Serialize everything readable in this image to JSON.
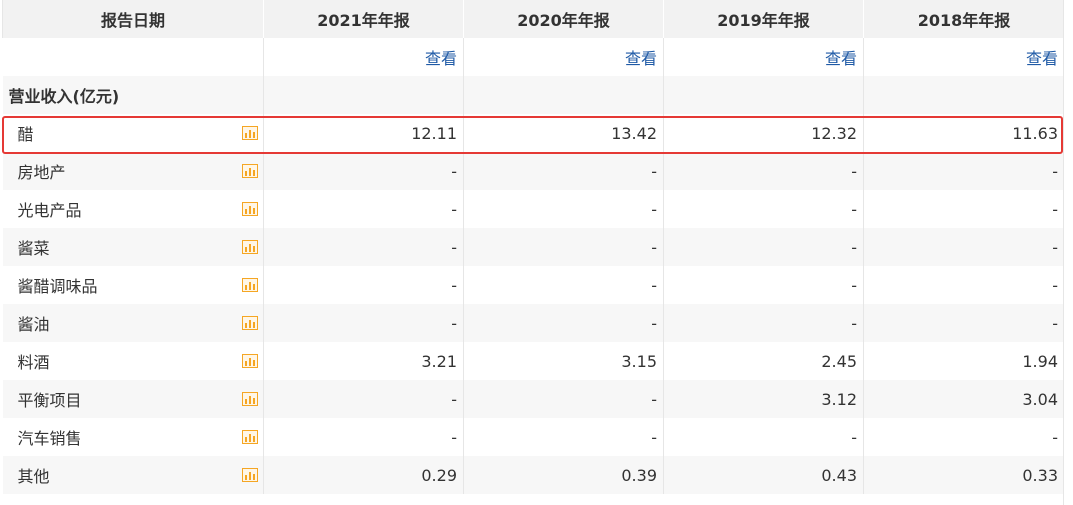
{
  "header": {
    "label": "报告日期",
    "periods": [
      "2021年年报",
      "2020年年报",
      "2019年年报",
      "2018年年报"
    ]
  },
  "view_row": {
    "link_label": "查看"
  },
  "section": {
    "title": "营业收入(亿元)"
  },
  "rows": [
    {
      "name": "醋",
      "values": [
        "12.11",
        "13.42",
        "12.32",
        "11.63"
      ],
      "highlighted": true
    },
    {
      "name": "房地产",
      "values": [
        "-",
        "-",
        "-",
        "-"
      ]
    },
    {
      "name": "光电产品",
      "values": [
        "-",
        "-",
        "-",
        "-"
      ]
    },
    {
      "name": "酱菜",
      "values": [
        "-",
        "-",
        "-",
        "-"
      ]
    },
    {
      "name": "酱醋调味品",
      "values": [
        "-",
        "-",
        "-",
        "-"
      ]
    },
    {
      "name": "酱油",
      "values": [
        "-",
        "-",
        "-",
        "-"
      ]
    },
    {
      "name": "料酒",
      "values": [
        "3.21",
        "3.15",
        "2.45",
        "1.94"
      ]
    },
    {
      "name": "平衡项目",
      "values": [
        "-",
        "-",
        "3.12",
        "3.04"
      ]
    },
    {
      "name": "汽车销售",
      "values": [
        "-",
        "-",
        "-",
        "-"
      ]
    },
    {
      "name": "其他",
      "values": [
        "0.29",
        "0.39",
        "0.43",
        "0.33"
      ]
    }
  ],
  "colors": {
    "highlight_border": "#e53935",
    "link": "#1f5aa6",
    "chart_icon": "#f5a623"
  },
  "icons": {
    "row_chart": "bar-chart-icon"
  }
}
